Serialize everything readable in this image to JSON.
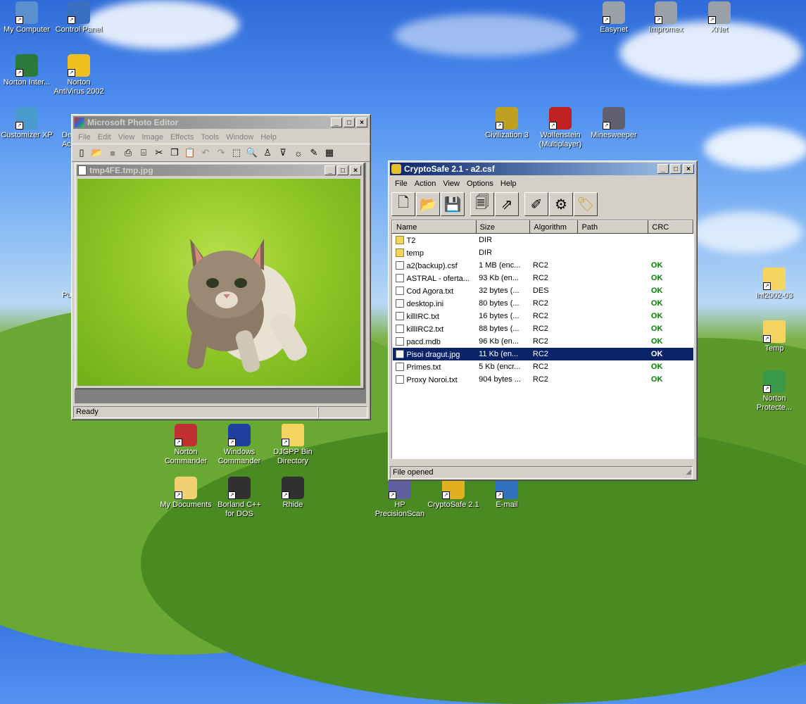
{
  "desktop": {
    "icons": [
      {
        "label": "My Computer",
        "icon": "my-computer-icon"
      },
      {
        "label": "Control Panel",
        "icon": "control-panel-icon"
      },
      {
        "label": "Norton Inter...",
        "icon": "norton-internet-icon"
      },
      {
        "label": "Norton AntiVirus 2002",
        "icon": "norton-antivirus-icon"
      },
      {
        "label": "Customizer XP",
        "icon": "customizer-icon"
      },
      {
        "label": "Easynet",
        "icon": "network-icon"
      },
      {
        "label": "Impromex",
        "icon": "network-icon"
      },
      {
        "label": "XNet",
        "icon": "network-icon"
      },
      {
        "label": "Civilization 3",
        "icon": "civilization-icon"
      },
      {
        "label": "Wolfenstein (Multiplayer)",
        "icon": "wolfenstein-icon"
      },
      {
        "label": "Minesweeper",
        "icon": "minesweeper-icon"
      },
      {
        "label": "Inf2002-03",
        "icon": "folder-icon"
      },
      {
        "label": "Temp",
        "icon": "folder-icon"
      },
      {
        "label": "Norton Protecte...",
        "icon": "recycle-bin-icon"
      },
      {
        "label": "Norton Commander",
        "icon": "norton-commander-icon"
      },
      {
        "label": "Windows Commander",
        "icon": "windows-commander-icon"
      },
      {
        "label": "DJGPP Bin Directory",
        "icon": "folder-icon"
      },
      {
        "label": "My Documents",
        "icon": "my-documents-icon"
      },
      {
        "label": "Borland C++ for DOS",
        "icon": "ms-dos-icon"
      },
      {
        "label": "Rhide",
        "icon": "ms-dos-icon"
      },
      {
        "label": "HP PrecisionScan",
        "icon": "scanner-icon"
      },
      {
        "label": "CryptoSafe 2.1",
        "icon": "key-icon"
      },
      {
        "label": "E-mail",
        "icon": "email-icon"
      },
      {
        "label": "De",
        "icon": "desktop-icon"
      },
      {
        "label": "Ac",
        "icon": "desktop-icon"
      },
      {
        "label": "Pu",
        "icon": "desktop-icon"
      }
    ]
  },
  "photo_editor": {
    "title": "Microsoft Photo Editor",
    "menu": [
      "File",
      "Edit",
      "View",
      "Image",
      "Effects",
      "Tools",
      "Window",
      "Help"
    ],
    "doc_title": "tmp4FE.tmp.jpg",
    "status": "Ready"
  },
  "cryptosafe": {
    "title": "CryptoSafe 2.1 - a2.csf",
    "menu": [
      "File",
      "Action",
      "View",
      "Options",
      "Help"
    ],
    "columns": [
      "Name",
      "Size",
      "Algorithm",
      "Path",
      "CRC"
    ],
    "rows": [
      {
        "name": "T2",
        "size": "DIR",
        "alg": "",
        "path": "",
        "crc": "",
        "type": "folder"
      },
      {
        "name": "temp",
        "size": "DIR",
        "alg": "",
        "path": "",
        "crc": "",
        "type": "folder"
      },
      {
        "name": "a2(backup).csf",
        "size": "1 MB (enc...",
        "alg": "RC2",
        "path": "",
        "crc": "OK",
        "type": "file"
      },
      {
        "name": "ASTRAL - oferta...",
        "size": "93 Kb (en...",
        "alg": "RC2",
        "path": "",
        "crc": "OK",
        "type": "file"
      },
      {
        "name": "Cod Agora.txt",
        "size": "32 bytes (...",
        "alg": "DES",
        "path": "",
        "crc": "OK",
        "type": "file"
      },
      {
        "name": "desktop.ini",
        "size": "80 bytes (...",
        "alg": "RC2",
        "path": "",
        "crc": "OK",
        "type": "file"
      },
      {
        "name": "killIRC.txt",
        "size": "16 bytes (...",
        "alg": "RC2",
        "path": "",
        "crc": "OK",
        "type": "file"
      },
      {
        "name": "killIRC2.txt",
        "size": "88 bytes (...",
        "alg": "RC2",
        "path": "",
        "crc": "OK",
        "type": "file"
      },
      {
        "name": "pacd.mdb",
        "size": "96 Kb (en...",
        "alg": "RC2",
        "path": "",
        "crc": "OK",
        "type": "file"
      },
      {
        "name": "Pisoi dragut.jpg",
        "size": "11 Kb (en...",
        "alg": "RC2",
        "path": "",
        "crc": "OK",
        "type": "file",
        "selected": true
      },
      {
        "name": "Primes.txt",
        "size": "5 Kb (encr...",
        "alg": "RC2",
        "path": "",
        "crc": "OK",
        "type": "file"
      },
      {
        "name": "Proxy Noroi.txt",
        "size": "904 bytes ...",
        "alg": "RC2",
        "path": "",
        "crc": "OK",
        "type": "file"
      }
    ],
    "status": "File opened"
  }
}
